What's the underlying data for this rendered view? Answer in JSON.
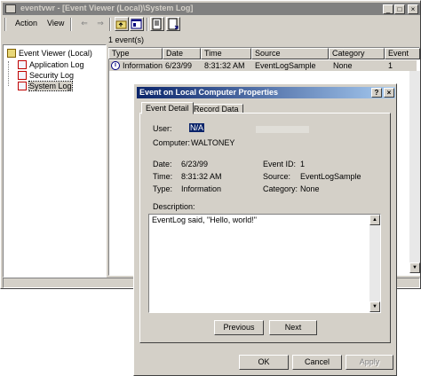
{
  "main_window": {
    "title": "eventvwr - [Event Viewer (Local)\\System Log]",
    "controls": {
      "minimize": "_",
      "maximize": "□",
      "close": "×"
    }
  },
  "menu": {
    "action": "Action",
    "view": "View"
  },
  "toolbar": {
    "back_glyph": "⇐",
    "forward_glyph": "⇒",
    "icons": [
      "back-icon",
      "forward-icon",
      "up-folder-icon",
      "properties-icon",
      "export-list-icon",
      "refresh-icon"
    ]
  },
  "tree": {
    "root": "Event Viewer (Local)",
    "items": [
      "Application Log",
      "Security Log",
      "System Log"
    ],
    "selected": "System Log"
  },
  "list": {
    "count_label": "1 event(s)",
    "columns": [
      "Type",
      "Date",
      "Time",
      "Source",
      "Category",
      "Event"
    ],
    "rows": [
      {
        "type": "Information",
        "date": "6/23/99",
        "time": "8:31:32 AM",
        "source": "EventLogSample",
        "category": "None",
        "event": "1"
      }
    ]
  },
  "dialog": {
    "title": "Event on Local Computer Properties",
    "help": "?",
    "close": "×",
    "tabs": [
      "Event Detail",
      "Record Data"
    ],
    "active_tab": "Event Detail",
    "fields": {
      "user_label": "User:",
      "user_value": "N/A",
      "computer_label": "Computer:",
      "computer_value": "WALTONEY",
      "date_label": "Date:",
      "date_value": "6/23/99",
      "time_label": "Time:",
      "time_value": "8:31:32 AM",
      "type_label": "Type:",
      "type_value": "Information",
      "event_id_label": "Event ID:",
      "event_id_value": "1",
      "source_label": "Source:",
      "source_value": "EventLogSample",
      "category_label": "Category:",
      "category_value": "None"
    },
    "description_label": "Description:",
    "description": "EventLog said, \"Hello, world!\"",
    "buttons": {
      "previous": "Previous",
      "next": "Next",
      "ok": "OK",
      "cancel": "Cancel",
      "apply": "Apply"
    }
  }
}
